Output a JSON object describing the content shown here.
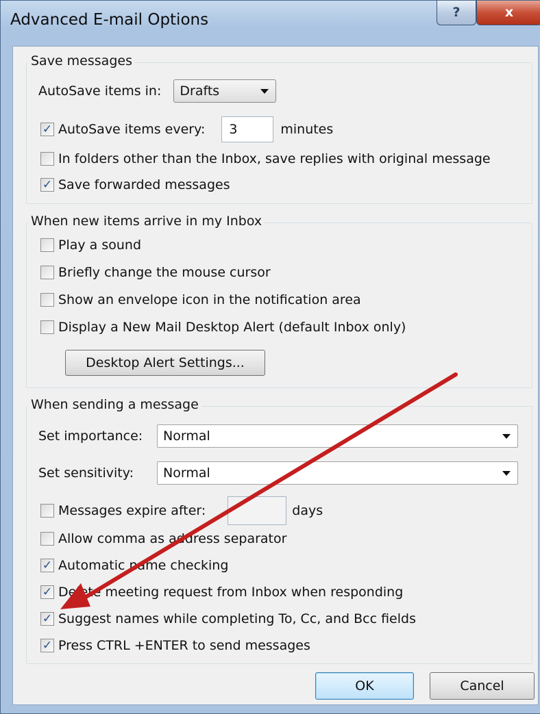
{
  "window": {
    "title": "Advanced E-mail Options",
    "help_glyph": "?",
    "close_glyph": "x"
  },
  "save": {
    "heading": "Save messages",
    "autosave_in_label": "AutoSave items in:",
    "autosave_in_value": "Drafts",
    "autosave_every_label": "AutoSave items every:",
    "autosave_every_checked": true,
    "autosave_every_value": "3",
    "minutes_label": "minutes",
    "replies_label": "In folders other than the Inbox, save replies with original message",
    "replies_checked": false,
    "forwarded_label": "Save forwarded messages",
    "forwarded_checked": true
  },
  "arrive": {
    "heading": "When new items arrive in my Inbox",
    "items": [
      {
        "label": "Play a sound",
        "checked": false
      },
      {
        "label": "Briefly change the mouse cursor",
        "checked": false
      },
      {
        "label": "Show an envelope icon in the notification area",
        "checked": false
      },
      {
        "label": "Display a New Mail Desktop Alert (default Inbox only)",
        "checked": false
      }
    ],
    "alert_button": "Desktop Alert Settings..."
  },
  "send": {
    "heading": "When sending a message",
    "importance_label": "Set importance:",
    "importance_value": "Normal",
    "sensitivity_label": "Set sensitivity:",
    "sensitivity_value": "Normal",
    "expire_label": "Messages expire after:",
    "expire_checked": false,
    "expire_value": "",
    "days_label": "days",
    "items": [
      {
        "label": "Allow comma as address separator",
        "checked": false
      },
      {
        "label": "Automatic name checking",
        "checked": true
      },
      {
        "label": "Delete meeting request from Inbox when responding",
        "checked": true
      },
      {
        "label": "Suggest names while completing To, Cc, and Bcc fields",
        "checked": true
      },
      {
        "label": "Press CTRL +ENTER to send messages",
        "checked": true
      }
    ]
  },
  "footer": {
    "ok": "OK",
    "cancel": "Cancel"
  },
  "colors": {
    "annotation_arrow": "#c41f1f",
    "check_mark": "#2b4f8e"
  },
  "icons": {
    "help": "help-icon",
    "close": "close-icon",
    "dropdown": "chevron-down-icon"
  }
}
